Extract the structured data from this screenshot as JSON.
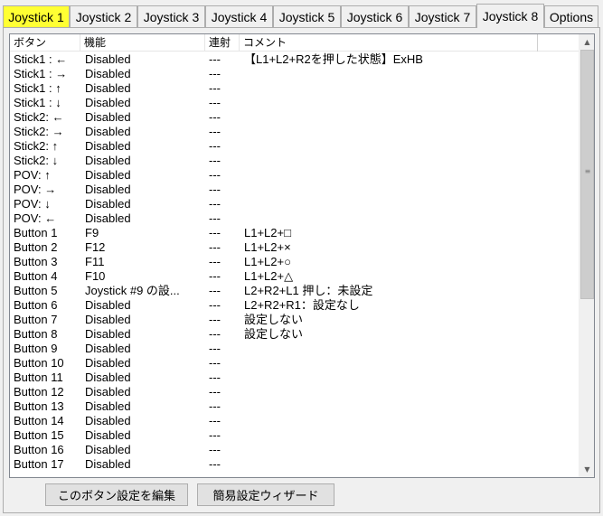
{
  "tabs": [
    "Joystick 1",
    "Joystick 2",
    "Joystick 3",
    "Joystick 4",
    "Joystick 5",
    "Joystick 6",
    "Joystick 7",
    "Joystick 8",
    "Options"
  ],
  "selected_tab": "Joystick 8",
  "highlight_color": "#ffff33",
  "columns": [
    "ボタン",
    "機能",
    "連射",
    "コメント"
  ],
  "rows": [
    {
      "button": "Stick1 : ←",
      "function": "Disabled",
      "rapid": "---",
      "comment": "【L1+L2+R2を押した状態】ExHB"
    },
    {
      "button": "Stick1 : →",
      "function": "Disabled",
      "rapid": "---",
      "comment": ""
    },
    {
      "button": "Stick1 : ↑",
      "function": "Disabled",
      "rapid": "---",
      "comment": ""
    },
    {
      "button": "Stick1 : ↓",
      "function": "Disabled",
      "rapid": "---",
      "comment": ""
    },
    {
      "button": "Stick2: ←",
      "function": "Disabled",
      "rapid": "---",
      "comment": ""
    },
    {
      "button": "Stick2: →",
      "function": "Disabled",
      "rapid": "---",
      "comment": ""
    },
    {
      "button": "Stick2: ↑",
      "function": "Disabled",
      "rapid": "---",
      "comment": ""
    },
    {
      "button": "Stick2: ↓",
      "function": "Disabled",
      "rapid": "---",
      "comment": ""
    },
    {
      "button": "POV: ↑",
      "function": "Disabled",
      "rapid": "---",
      "comment": ""
    },
    {
      "button": "POV: →",
      "function": "Disabled",
      "rapid": "---",
      "comment": ""
    },
    {
      "button": "POV: ↓",
      "function": "Disabled",
      "rapid": "---",
      "comment": ""
    },
    {
      "button": "POV: ←",
      "function": "Disabled",
      "rapid": "---",
      "comment": ""
    },
    {
      "button": "Button 1",
      "function": "F9",
      "rapid": "---",
      "comment": "L1+L2+□"
    },
    {
      "button": "Button 2",
      "function": "F12",
      "rapid": "---",
      "comment": "L1+L2+×"
    },
    {
      "button": "Button 3",
      "function": "F11",
      "rapid": "---",
      "comment": "L1+L2+○"
    },
    {
      "button": "Button 4",
      "function": "F10",
      "rapid": "---",
      "comment": "L1+L2+△"
    },
    {
      "button": "Button 5",
      "function": "Joystick #9 の設...",
      "rapid": "---",
      "comment": "L2+R2+L1 押し：未設定"
    },
    {
      "button": "Button 6",
      "function": "Disabled",
      "rapid": "---",
      "comment": "L2+R2+R1：設定なし"
    },
    {
      "button": "Button 7",
      "function": "Disabled",
      "rapid": "---",
      "comment": "設定しない"
    },
    {
      "button": "Button 8",
      "function": "Disabled",
      "rapid": "---",
      "comment": "設定しない"
    },
    {
      "button": "Button 9",
      "function": "Disabled",
      "rapid": "---",
      "comment": ""
    },
    {
      "button": "Button 10",
      "function": "Disabled",
      "rapid": "---",
      "comment": ""
    },
    {
      "button": "Button 11",
      "function": "Disabled",
      "rapid": "---",
      "comment": ""
    },
    {
      "button": "Button 12",
      "function": "Disabled",
      "rapid": "---",
      "comment": ""
    },
    {
      "button": "Button 13",
      "function": "Disabled",
      "rapid": "---",
      "comment": ""
    },
    {
      "button": "Button 14",
      "function": "Disabled",
      "rapid": "---",
      "comment": ""
    },
    {
      "button": "Button 15",
      "function": "Disabled",
      "rapid": "---",
      "comment": ""
    },
    {
      "button": "Button 16",
      "function": "Disabled",
      "rapid": "---",
      "comment": ""
    },
    {
      "button": "Button 17",
      "function": "Disabled",
      "rapid": "---",
      "comment": ""
    }
  ],
  "buttons": {
    "edit": "このボタン設定を編集",
    "wizard": "簡易設定ウィザード"
  }
}
